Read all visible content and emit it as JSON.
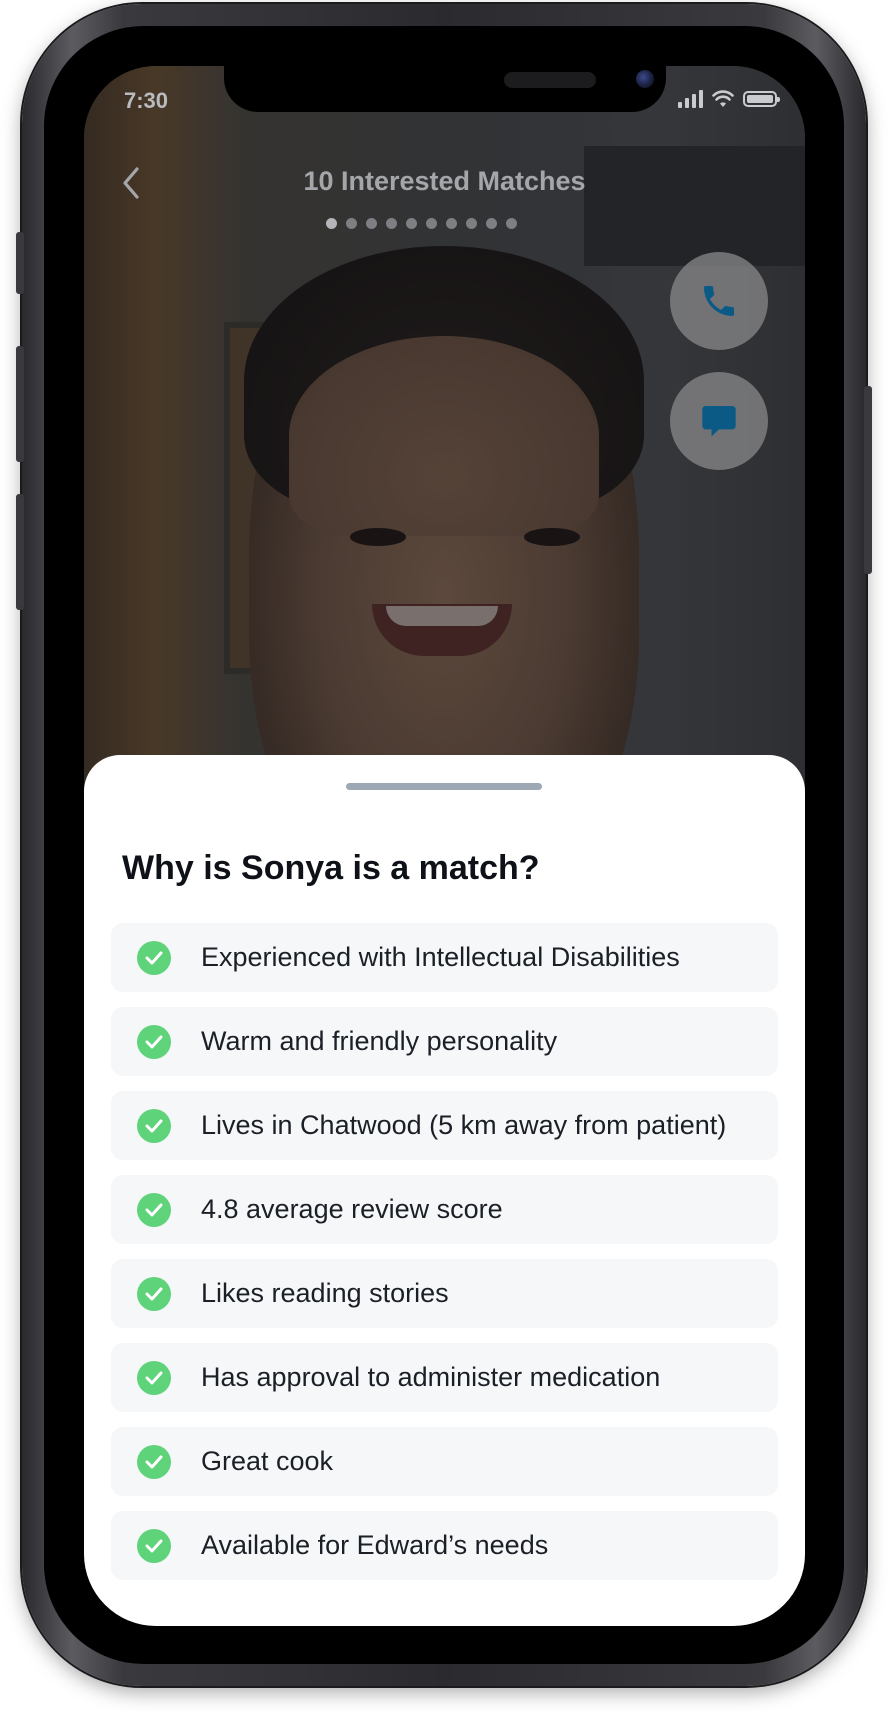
{
  "status_bar": {
    "time": "7:30"
  },
  "header": {
    "title": "10 Interested Matches",
    "page_count": 10,
    "active_page": 1
  },
  "actions": {
    "call": "phone-icon",
    "message": "chat-icon"
  },
  "sheet": {
    "title": "Why is Sonya is a match?",
    "reasons": [
      "Experienced with Intellectual Disabilities",
      "Warm and friendly personality",
      "Lives in Chatwood (5 km away from patient)",
      "4.8 average review score",
      "Likes reading stories",
      "Has approval to administer medication",
      "Great cook",
      "Available for Edward’s needs"
    ]
  },
  "colors": {
    "accent": "#0b5a86",
    "check": "#5fd37a",
    "handle": "#9da8b5"
  }
}
